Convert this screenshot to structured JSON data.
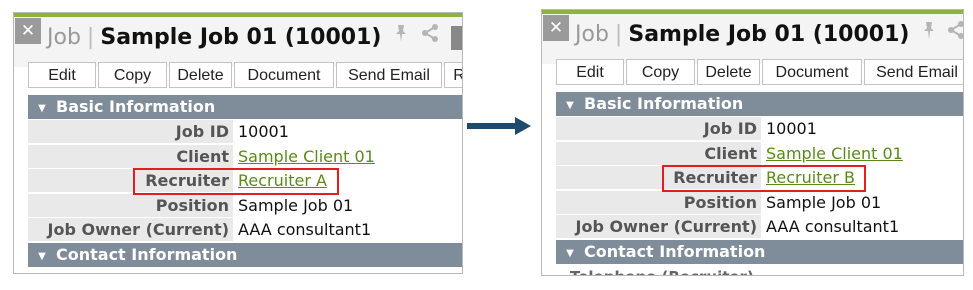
{
  "header": {
    "crumb": "Job",
    "separator": "|",
    "job_title": "Sample Job 01 (10001)",
    "close_glyph": "✕"
  },
  "toolbar": {
    "buttons": [
      "Edit",
      "Copy",
      "Delete",
      "Document",
      "Send Email",
      "R"
    ]
  },
  "basic_info": {
    "title": "Basic Information",
    "rows": [
      {
        "label": "Job ID",
        "value": "10001"
      },
      {
        "label": "Client",
        "value": "Sample Client 01"
      },
      {
        "label": "Recruiter",
        "value": "Recruiter A"
      },
      {
        "label": "Position",
        "value": "Sample Job 01"
      },
      {
        "label": "Job Owner (Current)",
        "value": "AAA consultant1"
      }
    ]
  },
  "contact_info": {
    "title": "Contact Information"
  },
  "after": {
    "recruiter_value": "Recruiter B",
    "cut_label": "Telephone (Recruiter)"
  },
  "icons": {
    "pin": "pin-icon",
    "share": "share-icon"
  },
  "colors": {
    "accent_bar": "#8cb43c",
    "section_header": "#7f8c99",
    "link": "#5a8a1a",
    "highlight": "#e02020",
    "arrow": "#1e4a6e"
  }
}
